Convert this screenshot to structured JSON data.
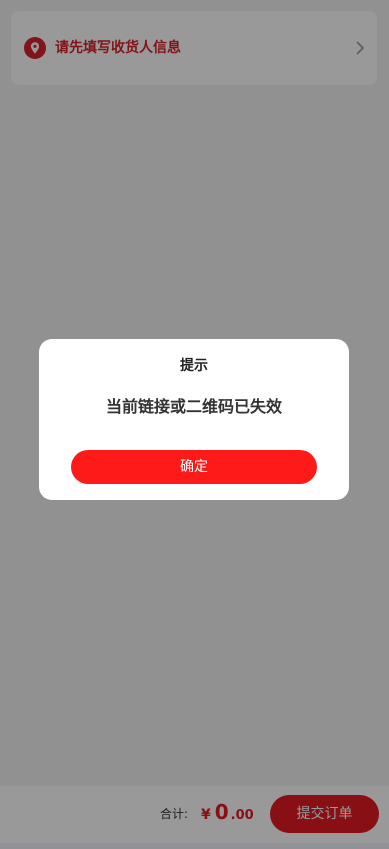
{
  "address": {
    "prompt": "请先填写收货人信息",
    "icon": "location-pin-icon",
    "chevron_icon": "chevron-right-icon"
  },
  "footer": {
    "total_label": "合计:",
    "currency": "¥",
    "amount_int": "0",
    "amount_dec": ".00",
    "submit_label": "提交订单"
  },
  "dialog": {
    "title": "提示",
    "message": "当前链接或二维码已失效",
    "confirm_label": "确定"
  },
  "colors": {
    "accent": "#e31b23",
    "dialog_button": "#ff1a1a",
    "overlay": "rgba(0,0,0,0.4)"
  }
}
